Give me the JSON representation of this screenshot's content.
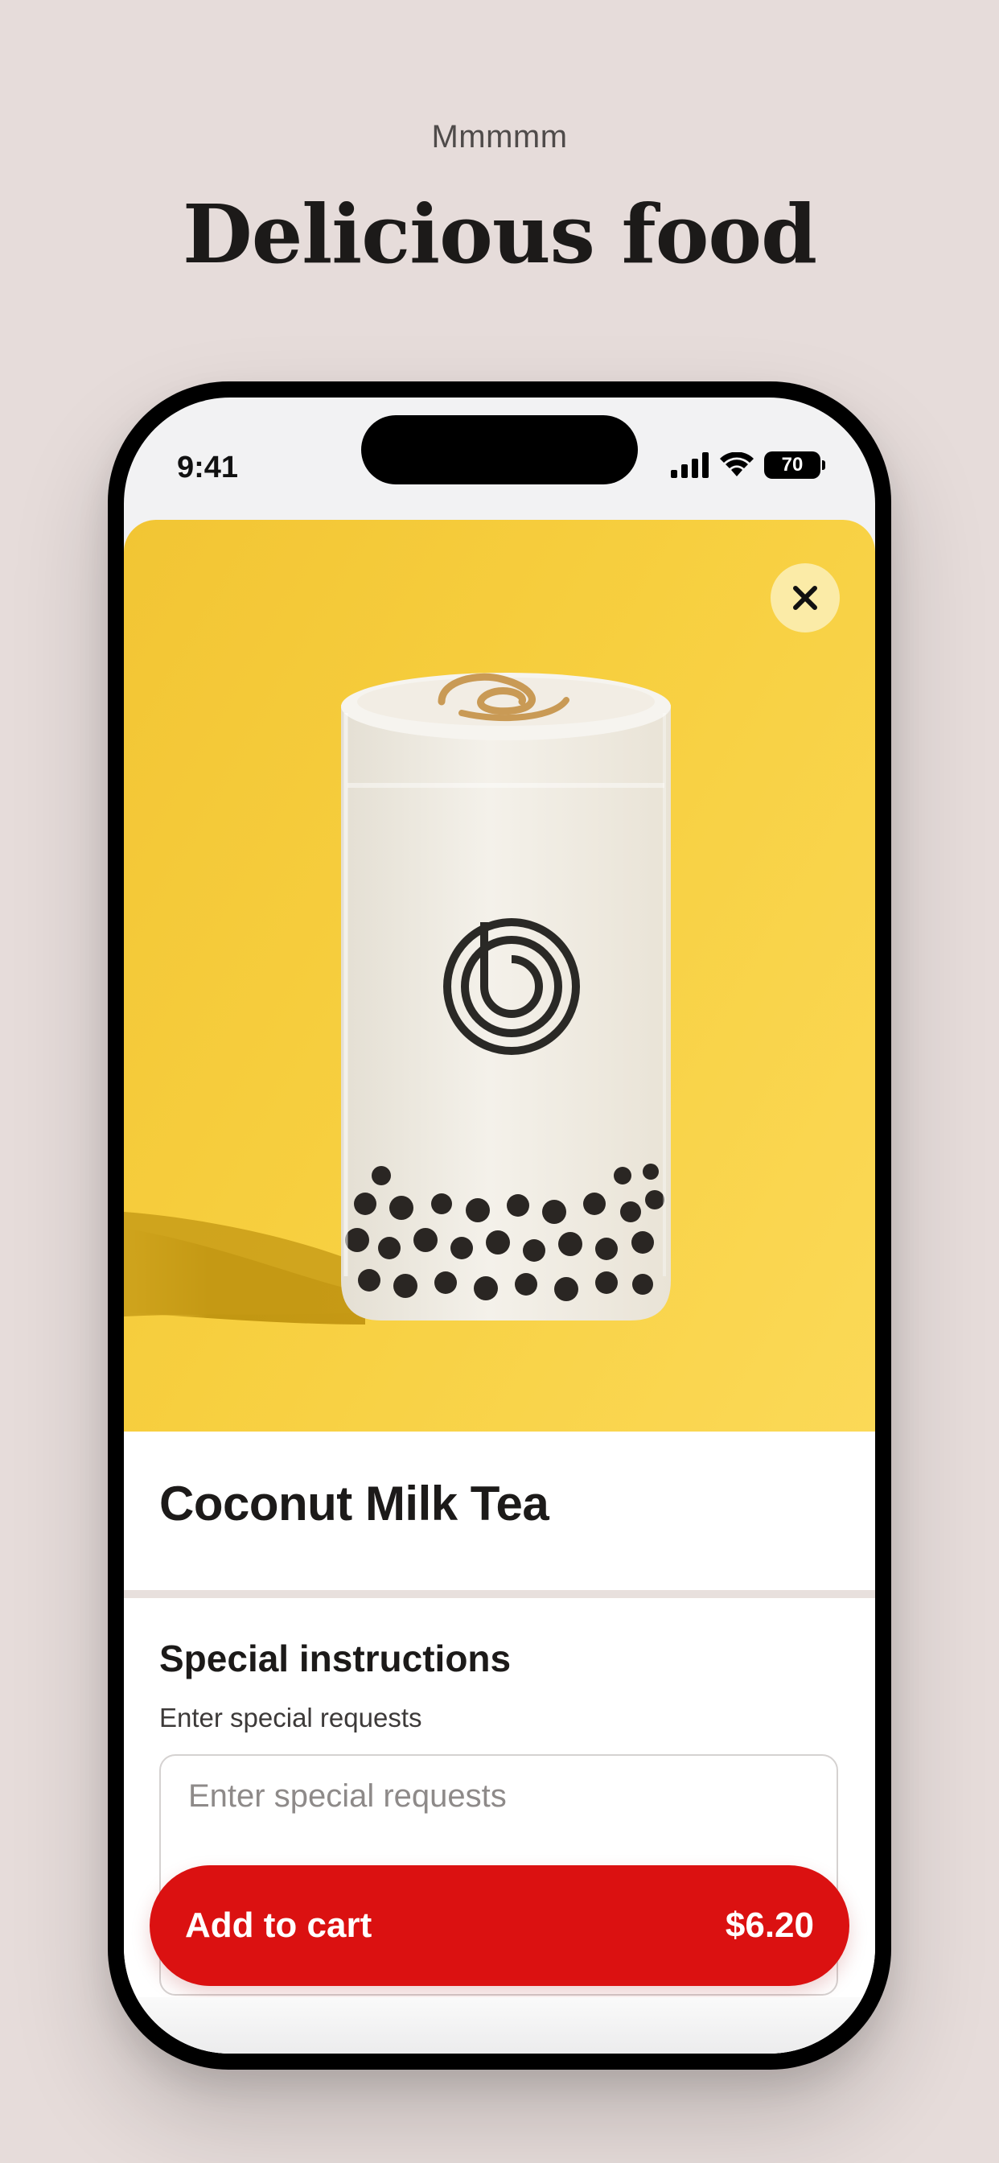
{
  "promo": {
    "eyebrow": "Mmmmm",
    "headline": "Delicious food"
  },
  "status_bar": {
    "time": "9:41",
    "battery": "70",
    "icons": [
      "signal-icon",
      "wifi-icon",
      "battery-icon"
    ]
  },
  "product": {
    "image_icon": "bubble-tea-image",
    "close_icon": "close-icon",
    "name": "Coconut Milk Tea"
  },
  "instructions": {
    "title": "Special instructions",
    "subtitle": "Enter special requests",
    "placeholder": "Enter special requests"
  },
  "cart": {
    "label": "Add to cart",
    "price": "$6.20"
  },
  "colors": {
    "background": "#e6dcda",
    "hero_yellow": "#f7cf3f",
    "accent_red": "#db1111"
  }
}
